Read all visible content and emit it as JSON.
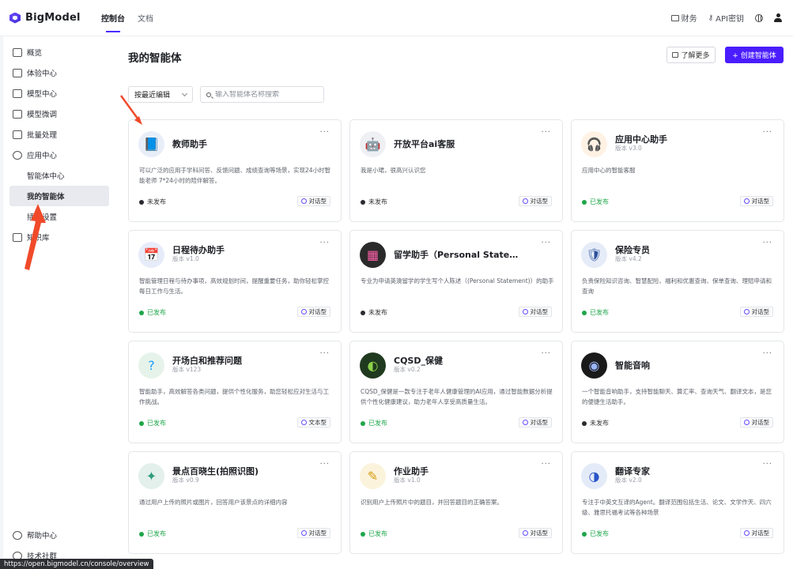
{
  "topbar": {
    "brand": "BigModel",
    "nav": [
      {
        "label": "控制台",
        "active": true
      },
      {
        "label": "文档",
        "active": false
      }
    ],
    "right": {
      "finance": "财务",
      "api_key": "API密钥"
    }
  },
  "sidebar": {
    "items": [
      {
        "label": "概览",
        "icon": "monitor-icon"
      },
      {
        "label": "体验中心",
        "icon": "chat-icon"
      },
      {
        "label": "模型中心",
        "icon": "cube-icon"
      },
      {
        "label": "模型微调",
        "icon": "tune-icon"
      },
      {
        "label": "批量处理",
        "icon": "batch-icon"
      },
      {
        "label": "应用中心",
        "icon": "robot-icon"
      }
    ],
    "sub_items": [
      {
        "label": "智能体中心",
        "active": false
      },
      {
        "label": "我的智能体",
        "active": true
      },
      {
        "label": "插件设置",
        "active": false
      }
    ],
    "knowledge": "知识库",
    "bottom": [
      {
        "label": "帮助中心",
        "icon": "help-icon"
      },
      {
        "label": "技术社群",
        "icon": "community-icon"
      }
    ]
  },
  "main": {
    "title": "我的智能体",
    "learn_more": "了解更多",
    "create": "+ 创建智能体",
    "sort_label": "按最近编辑",
    "search_placeholder": "输入智能体名称搜索"
  },
  "cards": [
    {
      "name": "教师助手",
      "version": "",
      "desc": "可以广泛的应用于学科问答、反馈问题、成绩查询等场景，实现24小时智能老师 7*24小时的陪伴解答。",
      "status": "未发布",
      "type": "对话型",
      "icon": "book-icon",
      "avatar_color": "#e8eef8"
    },
    {
      "name": "开放平台ai客服",
      "version": "",
      "desc": "我是小珺，很高兴认识您",
      "status": "未发布",
      "type": "对话型",
      "icon": "robot-avatar-icon",
      "avatar_color": "#eef0f4"
    },
    {
      "name": "应用中心助手",
      "version": "版本 v3.0",
      "desc": "应用中心的智能客服",
      "status": "已发布",
      "type": "对话型",
      "icon": "headset-icon",
      "avatar_color": "#fff2e4"
    },
    {
      "name": "日程待办助手",
      "version": "版本 v1.0",
      "desc": "智能管理日程与待办事项，高效规划时间，提醒重要任务，助你轻松掌控每日工作与生活。",
      "status": "已发布",
      "type": "对话型",
      "icon": "calendar-icon",
      "avatar_color": "#e7ecfb"
    },
    {
      "name": "留学助手（Personal State…",
      "version": "",
      "desc": "专业为申请英澳留学的学生写个人陈述（(Personal Statement)）的助手",
      "status": "未发布",
      "type": "对话型",
      "icon": "grid-icon",
      "avatar_color": "#2a2a2a"
    },
    {
      "name": "保险专员",
      "version": "版本 v4.2",
      "desc": "负责保险知识咨询、智慧配险、福利和优惠查询、保单查询、理赔申请和查询",
      "status": "已发布",
      "type": "对话型",
      "icon": "shield-icon",
      "avatar_color": "#e5ecf8"
    },
    {
      "name": "开场白和推荐问题",
      "version": "版本 v123",
      "desc": "智能助手，高效解答各类问题，提供个性化服务，助您轻松应对生活与工作挑战。",
      "status": "已发布",
      "type": "文本型",
      "icon": "question-icon",
      "avatar_color": "#e6f3ea"
    },
    {
      "name": "CQSD_保健",
      "version": "版本 v0.2",
      "desc": "CQSD_保健是一款专注于老年人健康管理的AI应用，通过智能数据分析提供个性化健康建议，助力老年人享受高质量生活。",
      "status": "已发布",
      "type": "对话型",
      "icon": "leaf-icon",
      "avatar_color": "#1f3a1f"
    },
    {
      "name": "智能音响",
      "version": "",
      "desc": "一个智能音响助手，支持智能聊天、算汇率、查询天气、翻译文本，是您的便捷生活助手。",
      "status": "未发布",
      "type": "对话型",
      "icon": "speaker-icon",
      "avatar_color": "#1a1a1a"
    },
    {
      "name": "景点百晓生(拍照识图)",
      "version": "版本 v0.9",
      "desc": "通过用户上传的照片或图片，回答用户该景点的详细内容",
      "status": "已发布",
      "type": "对话型",
      "icon": "compass-icon",
      "avatar_color": "#e3f0ec"
    },
    {
      "name": "作业助手",
      "version": "版本 v1.0",
      "desc": "识别用户上传照片中的题目，并回答题目的正确答案。",
      "status": "已发布",
      "type": "对话型",
      "icon": "homework-icon",
      "avatar_color": "#fbf3dc"
    },
    {
      "name": "翻译专家",
      "version": "版本 v2.0",
      "desc": "专注于中英文互译的Agent。翻译范围包括生活、论文、文学作天、四六级、雅思托福考试等各种场景",
      "status": "已发布",
      "type": "对话型",
      "icon": "translate-icon",
      "avatar_color": "#e4ebf8"
    }
  ],
  "status_url": "https://open.bigmodel.cn/console/overview",
  "colors": {
    "accent": "#4a1dff",
    "published": "#1fa64a",
    "unpublished": "#2a2c31",
    "annotation_arrow": "#f04a2a"
  }
}
